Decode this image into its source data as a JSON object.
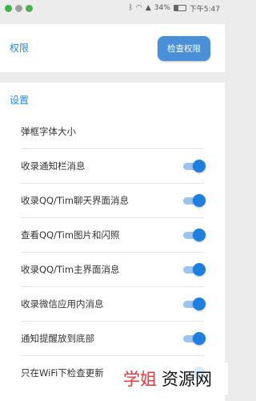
{
  "statusbar": {
    "battery": "34%",
    "time": "下午5:47"
  },
  "permissions": {
    "title": "权限",
    "check_button": "检查权限"
  },
  "settings": {
    "title": "设置",
    "items": [
      {
        "label": "弹框字体大小",
        "toggle": false
      },
      {
        "label": "收录通知栏消息",
        "toggle": true
      },
      {
        "label": "收录QQ/Tim聊天界面消息",
        "toggle": true
      },
      {
        "label": "查看QQ/Tim图片和闪照",
        "toggle": true
      },
      {
        "label": "收录QQ/Tim主界面消息",
        "toggle": true
      },
      {
        "label": "收录微信应用内消息",
        "toggle": true
      },
      {
        "label": "通知提醒放到底部",
        "toggle": true
      },
      {
        "label": "只在WiFi下检查更新",
        "toggle": true
      }
    ]
  },
  "watermark": {
    "red": "学姐",
    "black": "资源网"
  },
  "colors": {
    "accent": "#1e88e5",
    "button": "#4a90d9",
    "toggle_knob": "#1e7fe0",
    "toggle_track": "#9cc4ec",
    "watermark_red": "#e8383d"
  }
}
